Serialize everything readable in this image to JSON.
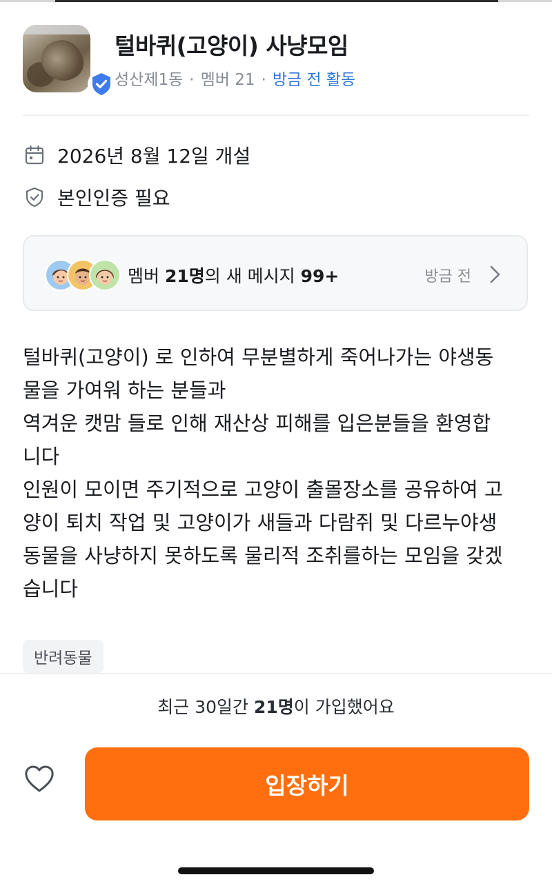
{
  "group": {
    "title": "털바퀴(고양이) 사냥모임",
    "location": "성산제1동",
    "members": "멤버 21",
    "activity": "방금 전 활동"
  },
  "info": {
    "created": "2026년 8월 12일 개설",
    "verification": "본인인증 필요"
  },
  "message_card": {
    "prefix": "멤버 ",
    "member_count": "21명",
    "middle": "의 새 메시지 ",
    "message_count": "99+",
    "time": "방금 전"
  },
  "description": [
    "털바퀴(고양이) 로 인하여 무분별하게 죽어나가는 야생동",
    "물을 가여워 하는 분들과",
    "역겨운 캣맘 들로 인해 재산상 피해를 입은분들을 환영합",
    "니다",
    "인원이 모이면 주기적으로 고양이 출몰장소를 공유하여 고",
    "양이 퇴치 작업 및 고양이가 새들과 다람쥐 및 다르누야생",
    "동물을 사냥하지 못하도록 물리적 조취를하는 모임을 갖겠",
    "습니다"
  ],
  "tag": "반려동물",
  "footer": {
    "joined_prefix": "최근 30일간 ",
    "joined_count": "21명",
    "joined_suffix": "이 가입했어요",
    "enter_button": "입장하기"
  },
  "colors": {
    "accent": "#ff6f0f",
    "link": "#2e7ad6",
    "verified_badge": "#3f7bea"
  },
  "icons": [
    "verified-badge-icon",
    "calendar-icon",
    "shield-check-icon",
    "chevron-right-icon",
    "heart-icon"
  ]
}
